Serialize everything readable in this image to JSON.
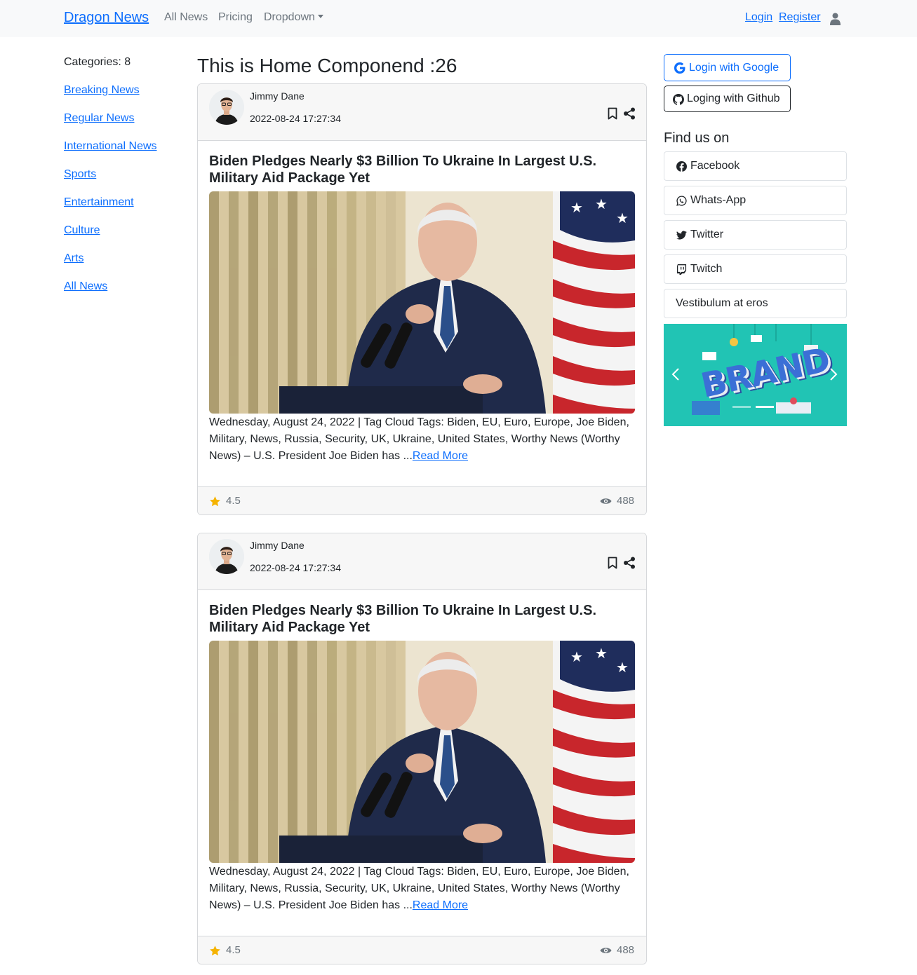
{
  "navbar": {
    "brand": "Dragon News",
    "links": [
      "All News",
      "Pricing",
      "Dropdown"
    ],
    "login": "Login",
    "register": "Register",
    "user_icon": "user-icon"
  },
  "sidebar_left": {
    "categories_label": "Categories: 8",
    "items": [
      "Breaking News",
      "Regular News",
      "International News",
      "Sports",
      "Entertainment",
      "Culture",
      "Arts",
      "All News"
    ]
  },
  "main": {
    "title": "This is Home Componend :26",
    "cards": [
      {
        "author": "Jimmy Dane",
        "date": "2022-08-24 17:27:34",
        "title": "Biden Pledges Nearly $3 Billion To Ukraine In Largest U.S. Military Aid Package Yet",
        "excerpt": "Wednesday, August 24, 2022 | Tag Cloud Tags: Biden, EU, Euro, Europe, Joe Biden, Military, News, Russia, Security, UK, Ukraine, United States, Worthy News (Worthy News) – U.S. President Joe Biden has ...",
        "read_more": "Read More",
        "rating": "4.5",
        "views": "488"
      },
      {
        "author": "Jimmy Dane",
        "date": "2022-08-24 17:27:34",
        "title": "Biden Pledges Nearly $3 Billion To Ukraine In Largest U.S. Military Aid Package Yet",
        "excerpt": "Wednesday, August 24, 2022 | Tag Cloud Tags: Biden, EU, Euro, Europe, Joe Biden, Military, News, Russia, Security, UK, Ukraine, United States, Worthy News (Worthy News) – U.S. President Joe Biden has ...",
        "read_more": "Read More",
        "rating": "4.5",
        "views": "488"
      }
    ]
  },
  "sidebar_right": {
    "google_button": "Login with Google",
    "github_button": "Loging with Github",
    "find_us_title": "Find us on",
    "social": [
      "Facebook",
      "Whats-App",
      "Twitter",
      "Twitch",
      "Vestibulum at eros"
    ],
    "carousel_text": "BRAND"
  },
  "colors": {
    "primary": "#0d6efd",
    "navbar_bg": "#f8f9fa",
    "star": "#f5b301",
    "carousel_bg": "#21c4b4"
  }
}
